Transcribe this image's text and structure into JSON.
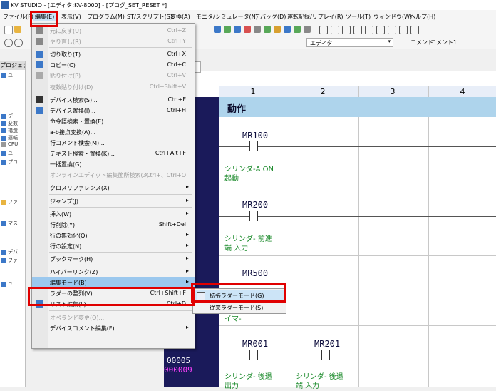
{
  "window": {
    "title": "KV STUDIO - [エディタ:KV-8000] - [プログ_SET_RESET *]"
  },
  "menubar": [
    "ファイル(F)",
    "編集(E)",
    "表示(V)",
    "プログラム(M)",
    "ST/スクリプト(S)",
    "変換(A)",
    "モニタ/シミュレータ(N)",
    "デバッグ(D)",
    "運転記録/リプレイ(R)",
    "ツール(T)",
    "ウィンドウ(W)",
    "ヘルプ(H)"
  ],
  "toolbar": {
    "editor_dropdown": "エディタ",
    "comment_dropdown": "コメント",
    "comment1_label": "コメント1"
  },
  "project_panel": {
    "tab_label": "プロジェクト",
    "tree_items": [
      "ユ",
      "デ",
      "変数",
      "構造",
      "運転",
      "CPU",
      "ユー",
      "プロ",
      "ファ",
      "マス",
      "デバ",
      "ファ",
      "ユ"
    ]
  },
  "edit_menu": {
    "items": [
      {
        "label": "元に戻す(U)",
        "shortcut": "Ctrl+Z",
        "disabled": true,
        "icon": "undo-icon"
      },
      {
        "label": "やり直し(R)",
        "shortcut": "Ctrl+Y",
        "disabled": true,
        "icon": "redo-icon"
      },
      {
        "sep": true
      },
      {
        "label": "切り取り(T)",
        "shortcut": "Ctrl+X",
        "icon": "cut-icon"
      },
      {
        "label": "コピー(C)",
        "shortcut": "Ctrl+C",
        "icon": "copy-icon"
      },
      {
        "label": "貼り付け(P)",
        "shortcut": "Ctrl+V",
        "disabled": true,
        "icon": "paste-icon"
      },
      {
        "label": "複数貼り付け(D)",
        "shortcut": "Ctrl+Shift+V",
        "disabled": true
      },
      {
        "sep": true
      },
      {
        "label": "デバイス検索(S)...",
        "shortcut": "Ctrl+F",
        "icon": "binoculars-icon"
      },
      {
        "label": "デバイス置換(I)...",
        "shortcut": "Ctrl+H",
        "icon": "replace-icon"
      },
      {
        "label": "命令語検索・置換(E)..."
      },
      {
        "label": "a-b接点変換(A)..."
      },
      {
        "label": "行コメント検索(M)..."
      },
      {
        "label": "テキスト検索・置換(K)...",
        "shortcut": "Ctrl+Alt+F"
      },
      {
        "label": "一括置換(G)..."
      },
      {
        "label": "オンラインエディット編集箇所検索(3)",
        "shortcut": "Ctrl+、Ctrl+O",
        "disabled": true
      },
      {
        "sep": true
      },
      {
        "label": "クロスリファレンス(X)",
        "submenu": true
      },
      {
        "sep": true
      },
      {
        "label": "ジャンプ(J)",
        "submenu": true
      },
      {
        "sep": true
      },
      {
        "label": "挿入(W)",
        "submenu": true
      },
      {
        "label": "行削除(Y)",
        "shortcut": "Shift+Del"
      },
      {
        "label": "行の無効化(Q)",
        "submenu": true
      },
      {
        "label": "行の設定(N)",
        "submenu": true
      },
      {
        "sep": true
      },
      {
        "label": "ブックマーク(H)",
        "submenu": true
      },
      {
        "sep": true
      },
      {
        "label": "ハイパーリンク(Z)",
        "submenu": true
      },
      {
        "label": "編集モード(B)",
        "submenu": true,
        "highlight": true
      },
      {
        "label": "ラダーの整列(V)",
        "shortcut": "Ctrl+Shift+F"
      },
      {
        "label": "リスト編集(L)...",
        "shortcut": "Ctrl+D",
        "icon": "list-icon"
      },
      {
        "sep": true
      },
      {
        "label": "オペランド変更(O)...",
        "disabled": true
      },
      {
        "label": "デバイスコメント編集(F)",
        "submenu": true
      }
    ]
  },
  "edit_mode_submenu": {
    "items": [
      "拡張ラダーモード(G)",
      "従来ラダーモード(S)"
    ]
  },
  "ladder": {
    "columns": [
      "1",
      "2",
      "3",
      "4"
    ],
    "banner": "動作",
    "devices": [
      "MR100",
      "MR200",
      "MR500",
      "MR001",
      "MR201"
    ],
    "comments": [
      "シリンダ-A ON",
      "起動",
      "シリンダ- 前進",
      "端 入力",
      "イマ-",
      "シリンダ- 後退",
      "出力",
      "シリンダ- 後退",
      "端 入力"
    ],
    "line_numbers": [
      "00005",
      "000009"
    ]
  },
  "colors": {
    "highlight": "#9bc8ee",
    "callout": "#e00000",
    "banner": "#aed4ec",
    "gutter": "#1a1a5a",
    "comment": "#1a8a2a"
  }
}
